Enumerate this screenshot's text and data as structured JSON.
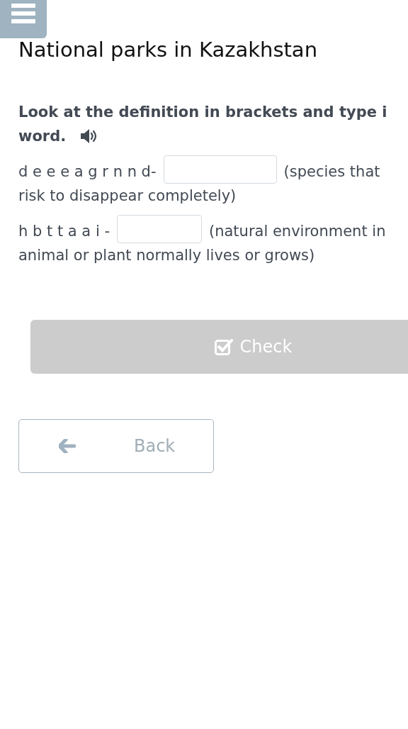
{
  "title": "National parks in Kazakhstan",
  "instruction": {
    "lines": [
      "Look at the definition in brackets and type i",
      "word."
    ]
  },
  "items": [
    {
      "letters": "d e e e a g r n n d-",
      "value": "",
      "definition_lines": [
        "(species that",
        "risk to disappear completely)"
      ]
    },
    {
      "letters": "h b t t a a i -",
      "value": "",
      "definition_lines": [
        "(natural environment in",
        "animal or plant normally lives or grows)"
      ]
    }
  ],
  "check_button": {
    "label": "Check",
    "disabled": true
  },
  "back_button": {
    "label": "Back"
  }
}
